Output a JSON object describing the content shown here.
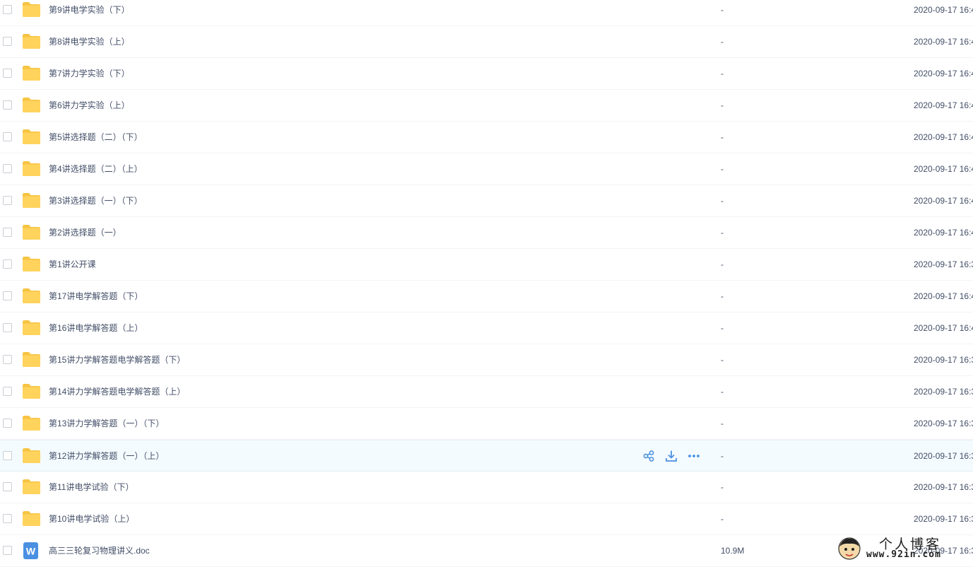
{
  "files": [
    {
      "name": "第9讲电学实验（下）",
      "size": "-",
      "date": "2020-09-17 16:4",
      "type": "folder"
    },
    {
      "name": "第8讲电学实验（上）",
      "size": "-",
      "date": "2020-09-17 16:4",
      "type": "folder"
    },
    {
      "name": "第7讲力学实验（下）",
      "size": "-",
      "date": "2020-09-17 16:4",
      "type": "folder"
    },
    {
      "name": "第6讲力学实验（上）",
      "size": "-",
      "date": "2020-09-17 16:4",
      "type": "folder"
    },
    {
      "name": "第5讲选择题（二）（下）",
      "size": "-",
      "date": "2020-09-17 16:4",
      "type": "folder"
    },
    {
      "name": "第4讲选择题（二）（上）",
      "size": "-",
      "date": "2020-09-17 16:4",
      "type": "folder"
    },
    {
      "name": "第3讲选择题（一）（下）",
      "size": "-",
      "date": "2020-09-17 16:4",
      "type": "folder"
    },
    {
      "name": "第2讲选择题（一）",
      "size": "-",
      "date": "2020-09-17 16:4",
      "type": "folder"
    },
    {
      "name": "第1讲公开课",
      "size": "-",
      "date": "2020-09-17 16:3",
      "type": "folder"
    },
    {
      "name": "第17讲电学解答题（下）",
      "size": "-",
      "date": "2020-09-17 16:4",
      "type": "folder"
    },
    {
      "name": "第16讲电学解答题（上）",
      "size": "-",
      "date": "2020-09-17 16:4",
      "type": "folder"
    },
    {
      "name": "第15讲力学解答题电学解答题（下）",
      "size": "-",
      "date": "2020-09-17 16:3",
      "type": "folder"
    },
    {
      "name": "第14讲力学解答题电学解答题（上）",
      "size": "-",
      "date": "2020-09-17 16:3",
      "type": "folder"
    },
    {
      "name": "第13讲力学解答题（一）（下）",
      "size": "-",
      "date": "2020-09-17 16:3",
      "type": "folder"
    },
    {
      "name": "第12讲力学解答题（一）（上）",
      "size": "-",
      "date": "2020-09-17 16:3",
      "type": "folder",
      "hover": true
    },
    {
      "name": "第11讲电学试验（下）",
      "size": "-",
      "date": "2020-09-17 16:3",
      "type": "folder"
    },
    {
      "name": "第10讲电学试验（上）",
      "size": "-",
      "date": "2020-09-17 16:3",
      "type": "folder"
    },
    {
      "name": "高三三轮复习物理讲义.doc",
      "size": "10.9M",
      "date": "2020-09-17 16:3",
      "type": "doc"
    }
  ],
  "row_actions": [
    "share-icon",
    "download-icon",
    "more-icon"
  ],
  "watermark": {
    "title": "个人博客",
    "url": "www.92in.com"
  },
  "colors": {
    "folder": "#ffd35c",
    "accent": "#4a8fe0",
    "hover_bg": "#f4fbff",
    "doc": "#4a90e2"
  }
}
